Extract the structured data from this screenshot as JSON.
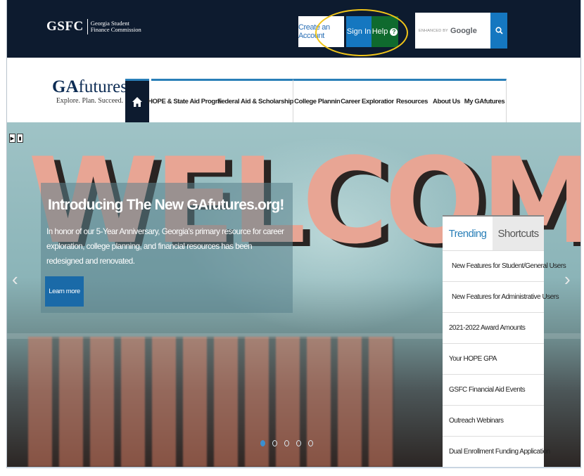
{
  "header": {
    "logo_mark": "GSFC",
    "logo_name_line1": "Georgia Student",
    "logo_name_line2": "Finance Commission",
    "create_account": "Create an Account",
    "sign_in": "Sign In",
    "help": "Help",
    "help_icon": "?",
    "search_enhanced": "ENHANCED BY",
    "search_brand": "Google",
    "search_placeholder": ""
  },
  "brand": {
    "title_bold": "GA",
    "title_rest": "futures",
    "tagline": "Explore. Plan. Succeed."
  },
  "nav": {
    "items": [
      {
        "label": "HOPE & State Aid Programs"
      },
      {
        "label": "Federal Aid & Scholarships"
      },
      {
        "label": "College Planning"
      },
      {
        "label": "Career Exploration"
      },
      {
        "label": "Resources"
      },
      {
        "label": "About Us"
      },
      {
        "label": "My GAfutures"
      }
    ]
  },
  "hero": {
    "background_word": "WELCOME",
    "title": "Introducing The New GAfutures.org!",
    "text": "In honor of our 5-Year Anniversary, Georgia's primary resource for career exploration, college planning, and financial resources has been redesigned and renovated.",
    "button": "Learn more",
    "prev_arrow": "‹",
    "next_arrow": "›",
    "slides": 5,
    "active_slide": 1
  },
  "trending": {
    "tabs": [
      "Trending",
      "Shortcuts"
    ],
    "items": [
      {
        "label": "New Features for Student/General Users",
        "icon": "diamond-icon"
      },
      {
        "label": "New Features for Administrative Users",
        "icon": "diamond-icon"
      },
      {
        "label": "2021-2022 Award Amounts"
      },
      {
        "label": "Your HOPE GPA"
      },
      {
        "label": "GSFC Financial Aid Events"
      },
      {
        "label": "Outreach Webinars"
      },
      {
        "label": "Dual Enrollment Funding Application"
      }
    ]
  },
  "colors": {
    "header_bg": "#0d1b2f",
    "primary_blue": "#1577c0",
    "help_green": "#0f6a2e",
    "highlight": "#f0c419"
  }
}
